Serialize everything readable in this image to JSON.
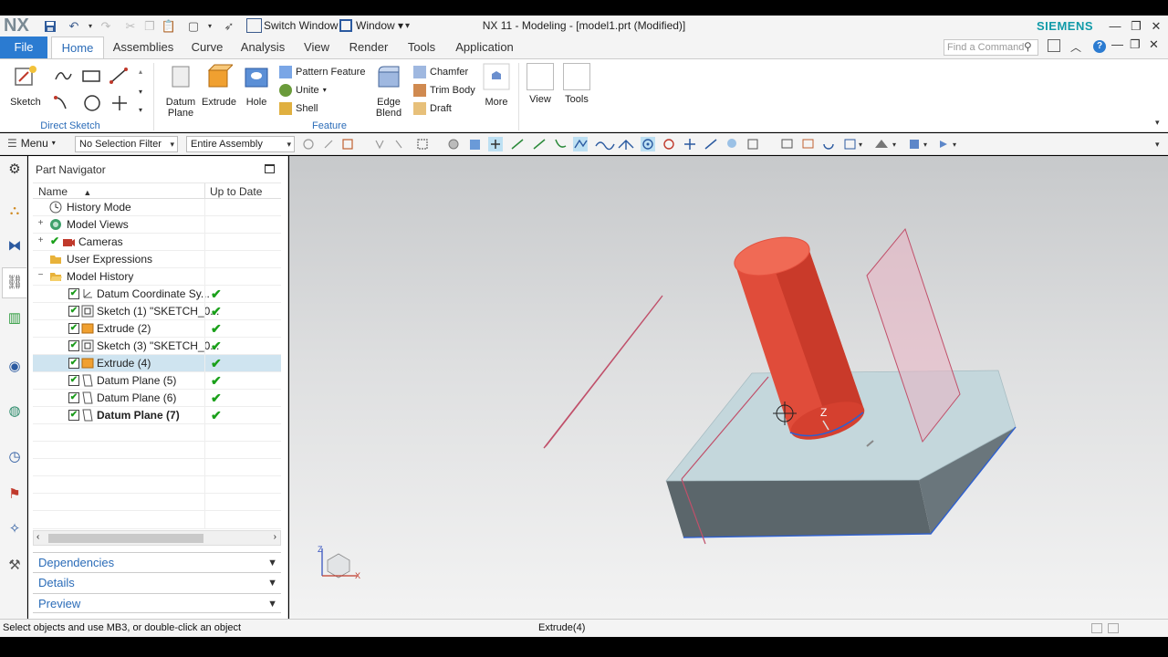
{
  "app": {
    "logo": "NX",
    "title": "NX 11 - Modeling - [model1.prt (Modified)]",
    "brand": "SIEMENS",
    "switch_window": "Switch Window",
    "window_menu": "Window ▾"
  },
  "tabs": [
    "File",
    "Home",
    "Assemblies",
    "Curve",
    "Analysis",
    "View",
    "Render",
    "Tools",
    "Application"
  ],
  "find_command_placeholder": "Find a Command",
  "ribbon": {
    "sketch": "Sketch",
    "direct_sketch": "Direct Sketch",
    "datum_plane": "Datum Plane",
    "extrude": "Extrude",
    "hole": "Hole",
    "pattern_feature": "Pattern Feature",
    "unite": "Unite",
    "shell": "Shell",
    "edge_blend": "Edge Blend",
    "chamfer": "Chamfer",
    "trim_body": "Trim Body",
    "draft": "Draft",
    "more": "More",
    "feature": "Feature",
    "view": "View",
    "tools": "Tools"
  },
  "selection_bar": {
    "menu": "Menu",
    "filter": "No Selection Filter",
    "scope": "Entire Assembly"
  },
  "navigator": {
    "title": "Part Navigator",
    "col_name": "Name",
    "col_up_to_date": "Up to Date",
    "rows": [
      {
        "label": "History Mode",
        "status": ""
      },
      {
        "label": "Model Views",
        "status": ""
      },
      {
        "label": "Cameras",
        "status": ""
      },
      {
        "label": "User Expressions",
        "status": ""
      },
      {
        "label": "Model History",
        "status": ""
      },
      {
        "label": "Datum Coordinate Sy...",
        "status": "✔"
      },
      {
        "label": "Sketch (1) \"SKETCH_0...",
        "status": "✔"
      },
      {
        "label": "Extrude (2)",
        "status": "✔"
      },
      {
        "label": "Sketch (3) \"SKETCH_0...",
        "status": "✔"
      },
      {
        "label": "Extrude (4)",
        "status": "✔"
      },
      {
        "label": "Datum Plane (5)",
        "status": "✔"
      },
      {
        "label": "Datum Plane (6)",
        "status": "✔"
      },
      {
        "label": "Datum Plane (7)",
        "status": "✔"
      }
    ],
    "sections": [
      "Dependencies",
      "Details",
      "Preview"
    ]
  },
  "viewport": {
    "z_label": "Z",
    "triad_x": "X",
    "triad_z": "Z"
  },
  "status": {
    "message": "Select objects and use MB3, or double-click an object",
    "feature": "Extrude(4)"
  },
  "colors": {
    "accent": "#2b7bd1",
    "cylinder": "#e0523f",
    "block_top": "#c5d9de",
    "block_side": "#5e6a70",
    "datum_plane": "#c0506a",
    "selected_row": "#cfe4f0"
  }
}
